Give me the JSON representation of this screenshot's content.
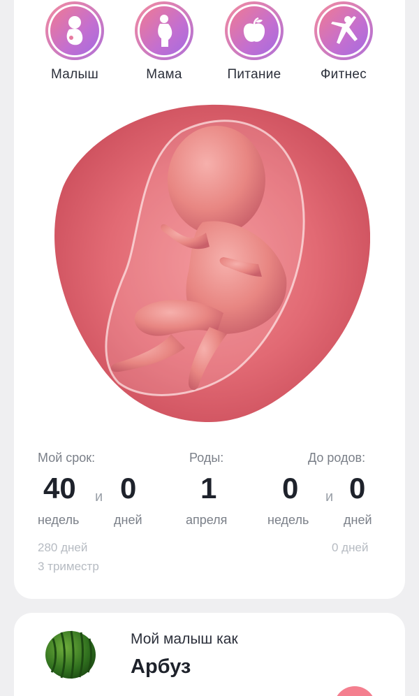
{
  "categories": [
    {
      "label": "Малыш",
      "icon": "baby-icon"
    },
    {
      "label": "Мама",
      "icon": "pregnant-woman-icon"
    },
    {
      "label": "Питание",
      "icon": "apple-icon"
    },
    {
      "label": "Фитнес",
      "icon": "fitness-icon"
    }
  ],
  "term": {
    "my_term_label": "Мой срок:",
    "weeks": "40",
    "and": "и",
    "days": "0",
    "weeks_unit": "недель",
    "days_unit": "дней",
    "total_days": "280 дней",
    "trimester": "3 триместр"
  },
  "birth": {
    "label": "Роды:",
    "day": "1",
    "month": "апреля"
  },
  "until_birth": {
    "label": "До родов:",
    "weeks": "0",
    "and": "и",
    "days": "0",
    "weeks_unit": "недель",
    "days_unit": "дней",
    "total_days": "0 дней"
  },
  "fruit_card": {
    "title": "Мой малыш как",
    "fruit": "Арбуз",
    "image": "watermelon"
  },
  "colors": {
    "accent_gradient_start": "#f28aa0",
    "accent_gradient_end": "#b06fd8",
    "fab": "#f47f8f"
  }
}
